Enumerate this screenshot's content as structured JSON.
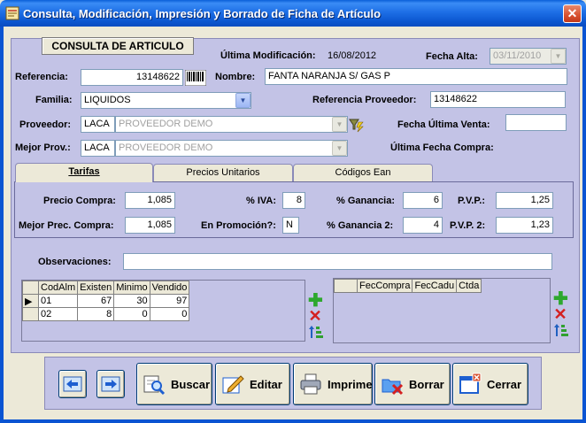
{
  "window": {
    "title": "Consulta, Modificación, Impresión y Borrado de Ficha de Artículo",
    "close_label": "✕"
  },
  "header": {
    "section_title": "CONSULTA DE ARTICULO",
    "ultima_mod_label": "Última Modificación:",
    "ultima_mod_value": "16/08/2012",
    "fecha_alta_label": "Fecha Alta:",
    "fecha_alta_value": "03/11/2010"
  },
  "form": {
    "referencia_label": "Referencia:",
    "referencia_value": "13148622",
    "nombre_label": "Nombre:",
    "nombre_value": "FANTA NARANJA S/ GAS P",
    "familia_label": "Familia:",
    "familia_value": "LIQUIDOS",
    "ref_proveedor_label": "Referencia Proveedor:",
    "ref_proveedor_value": "13148622",
    "proveedor_label": "Proveedor:",
    "proveedor_code": "LACA",
    "proveedor_name": "PROVEEDOR DEMO",
    "fecha_ultima_venta_label": "Fecha Última Venta:",
    "fecha_ultima_venta_value": "",
    "mejor_prov_label": "Mejor Prov.:",
    "mejor_prov_code": "LACA",
    "mejor_prov_name": "PROVEEDOR DEMO",
    "ultima_compra_label": "Última Fecha Compra:"
  },
  "tabs": [
    {
      "label": "Tarifas"
    },
    {
      "label": "Precios Unitarios"
    },
    {
      "label": "Códigos Ean"
    }
  ],
  "tarifas": {
    "precio_compra_label": "Precio Compra:",
    "precio_compra_value": "1,085",
    "iva_label": "% IVA:",
    "iva_value": "8",
    "ganancia_label": "% Ganancia:",
    "ganancia_value": "6",
    "pvp_label": "P.V.P.:",
    "pvp_value": "1,25",
    "mejor_precio_label": "Mejor Prec. Compra:",
    "mejor_precio_value": "1,085",
    "promocion_label": "En Promoción?:",
    "promocion_value": "N",
    "ganancia2_label": "% Ganancia 2:",
    "ganancia2_value": "4",
    "pvp2_label": "P.V.P. 2:",
    "pvp2_value": "1,23"
  },
  "observaciones": {
    "label": "Observaciones:",
    "value": ""
  },
  "stock_grid": {
    "headers": [
      "CodAlm",
      "Existen",
      "Minimo",
      "Vendido"
    ],
    "rows": [
      [
        "01",
        "67",
        "30",
        "97"
      ],
      [
        "02",
        "8",
        "0",
        "0"
      ]
    ]
  },
  "compras_grid": {
    "headers": [
      "FecCompra",
      "FecCadu",
      "Ctda"
    ]
  },
  "toolbar": {
    "buscar": "Buscar",
    "editar": "Editar",
    "imprime": "Imprime",
    "borrar": "Borrar",
    "cerrar": "Cerrar"
  },
  "colors": {
    "titlebar": "#0A5FD8",
    "panel": "#C3C3E6",
    "window_bg": "#ECE9D8"
  }
}
